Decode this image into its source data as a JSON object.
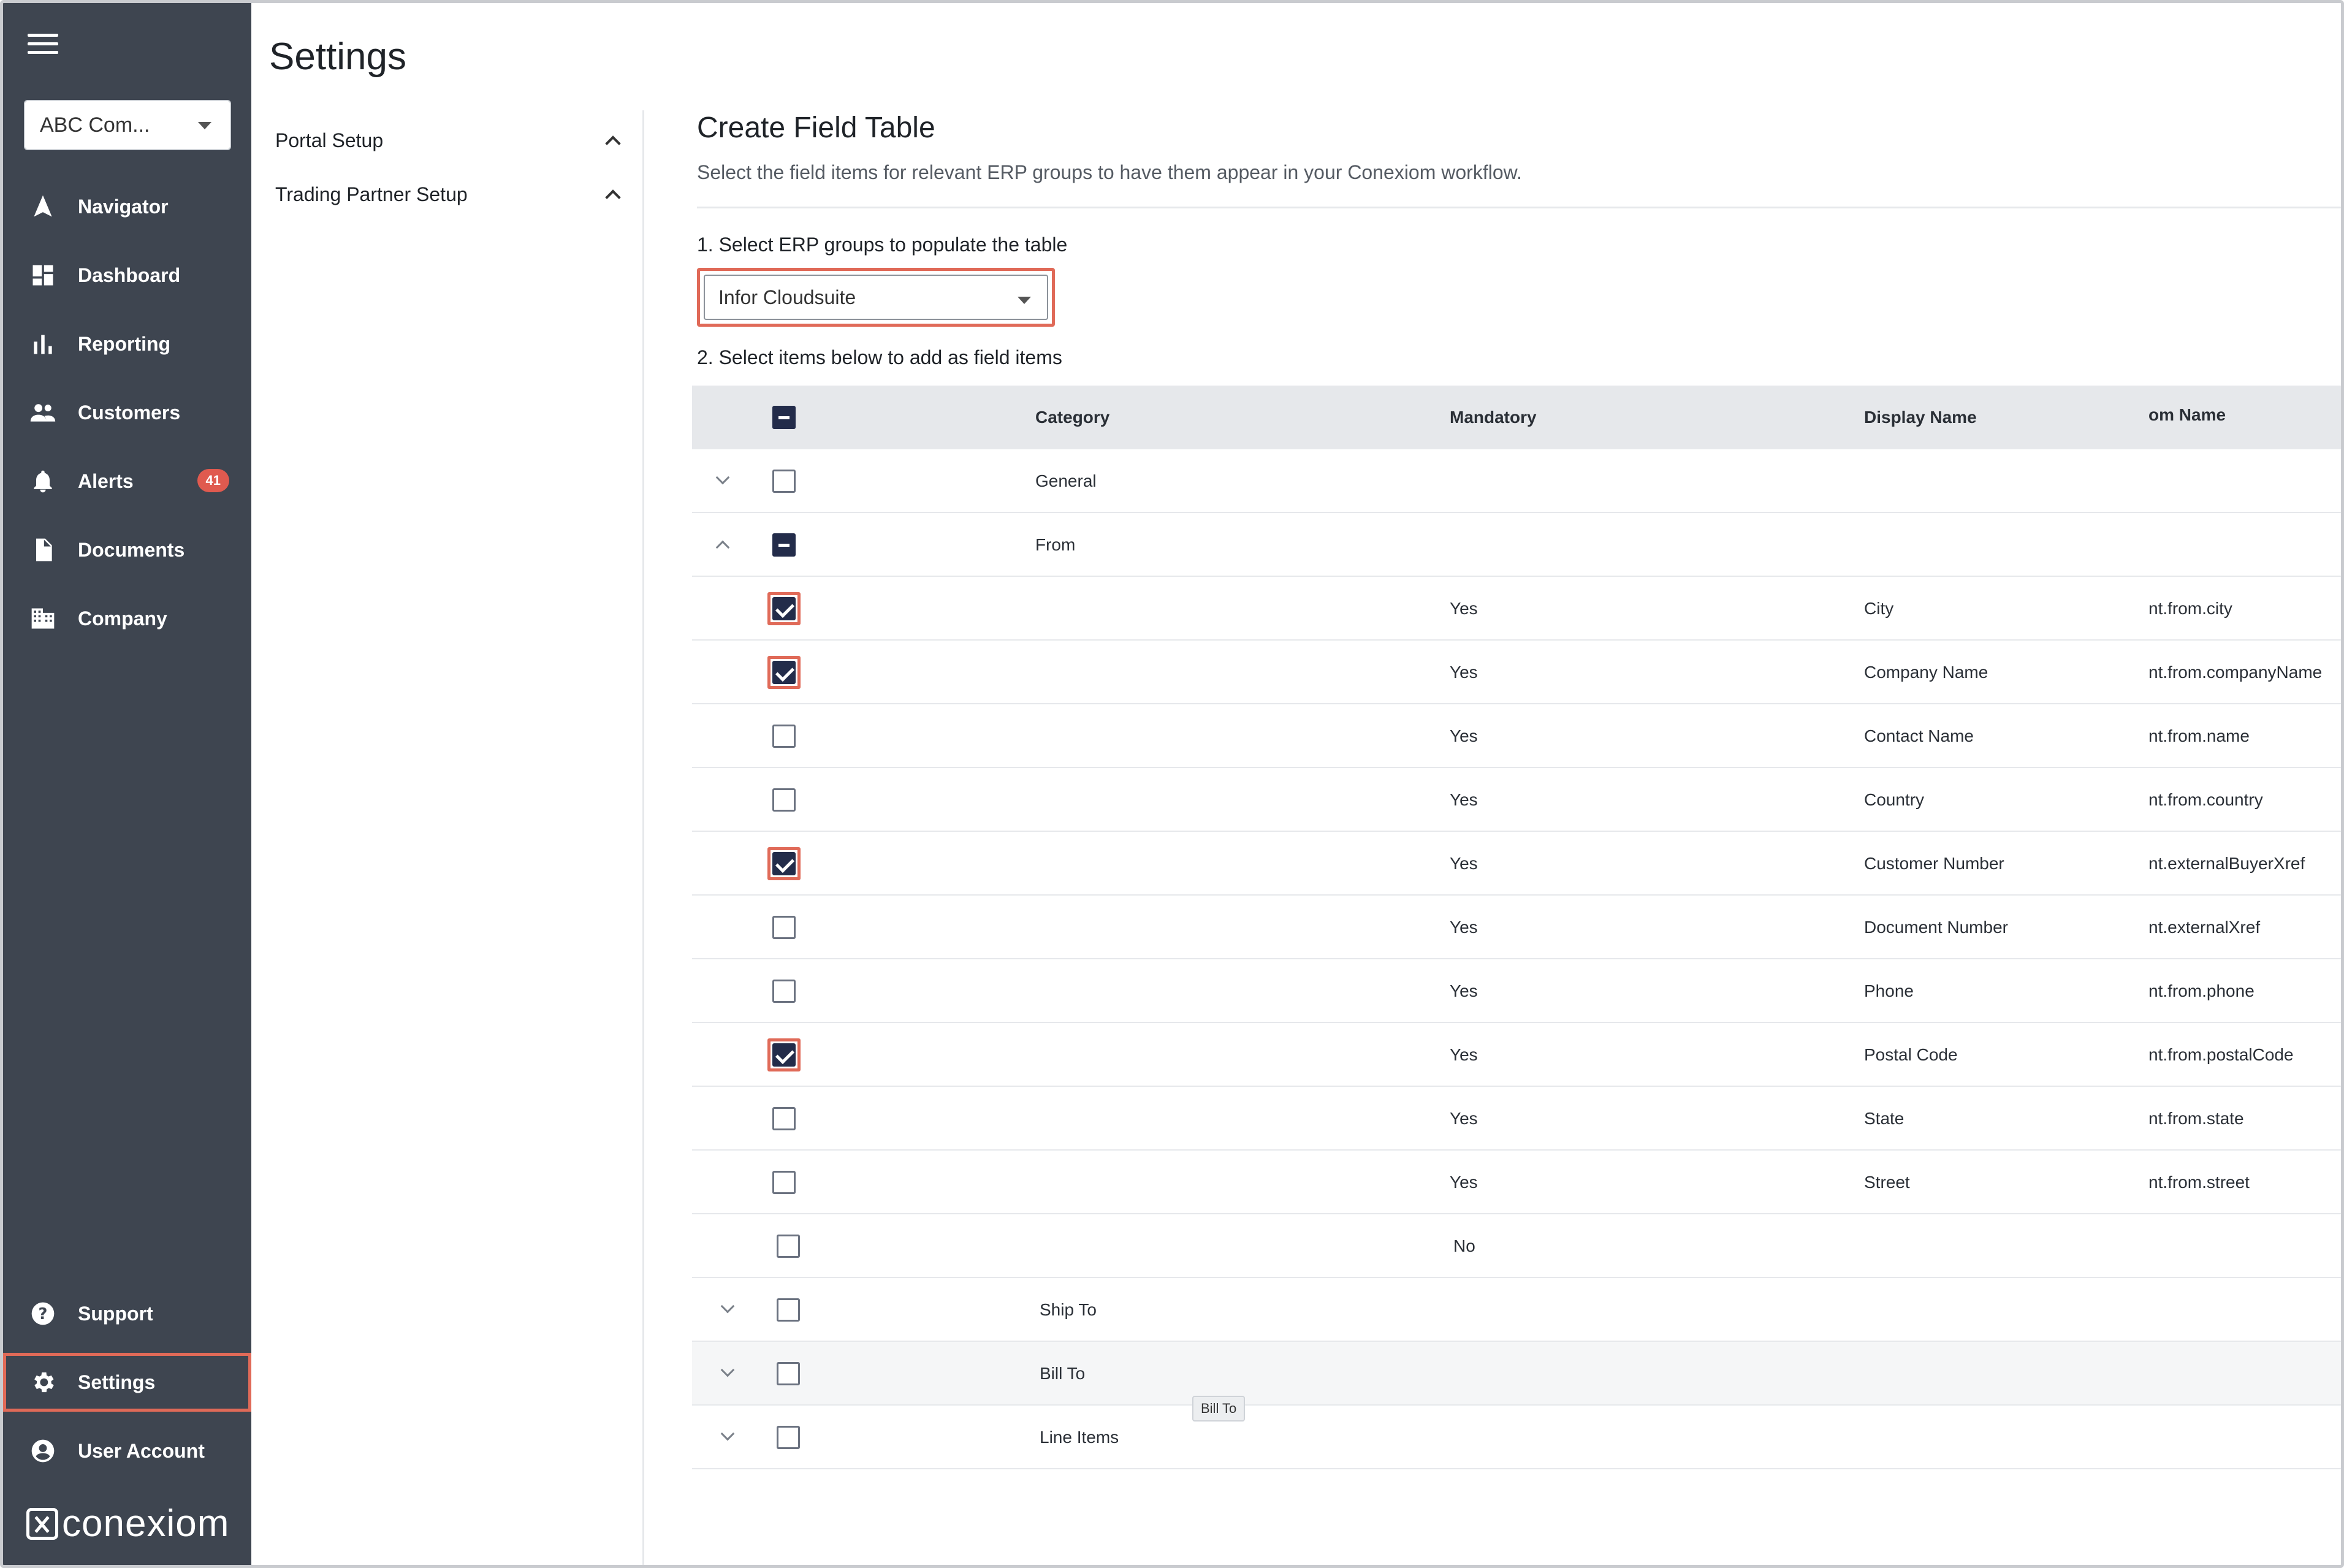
{
  "sidebar": {
    "company_selector": "ABC Com...",
    "nav": [
      {
        "label": "Navigator",
        "icon": "navigator-arrow-icon"
      },
      {
        "label": "Dashboard",
        "icon": "dashboard-icon"
      },
      {
        "label": "Reporting",
        "icon": "bar-chart-icon"
      },
      {
        "label": "Customers",
        "icon": "people-icon"
      },
      {
        "label": "Alerts",
        "icon": "bell-icon",
        "badge": "41"
      },
      {
        "label": "Documents",
        "icon": "document-icon"
      },
      {
        "label": "Company",
        "icon": "building-icon"
      }
    ],
    "bottom_nav": [
      {
        "label": "Support",
        "icon": "help-icon"
      },
      {
        "label": "Settings",
        "icon": "gear-icon",
        "active": true
      },
      {
        "label": "User Account",
        "icon": "user-circle-icon"
      }
    ],
    "logo_text": "conexiom"
  },
  "page": {
    "title": "Settings"
  },
  "subnav": {
    "items": [
      {
        "label": "Portal Setup"
      },
      {
        "label": "Trading Partner Setup"
      }
    ]
  },
  "main": {
    "title": "Create Field Table",
    "description": "Select the field items for relevant ERP groups to have them appear in your Conexiom workflow.",
    "step1": "1. Select ERP groups to populate the table",
    "erp_selected": "Infor Cloudsuite",
    "step2": "2. Select items below to add as field items"
  },
  "table": {
    "columns": [
      "Category",
      "Mandatory",
      "Display Name",
      "om Name"
    ],
    "groups": [
      {
        "category": "General"
      },
      {
        "category": "From"
      },
      {
        "category": "Ship To"
      },
      {
        "category": "Bill To"
      },
      {
        "category": "Line Items"
      }
    ],
    "rows": [
      {
        "mandatory": "Yes",
        "display_name": "City",
        "custom_name": "nt.from.city",
        "checked": true
      },
      {
        "mandatory": "Yes",
        "display_name": "Company Name",
        "custom_name": "nt.from.companyName",
        "checked": true
      },
      {
        "mandatory": "Yes",
        "display_name": "Contact Name",
        "custom_name": "nt.from.name",
        "checked": false
      },
      {
        "mandatory": "Yes",
        "display_name": "Country",
        "custom_name": "nt.from.country",
        "checked": false
      },
      {
        "mandatory": "Yes",
        "display_name": "Customer Number",
        "custom_name": "nt.externalBuyerXref",
        "checked": true
      },
      {
        "mandatory": "Yes",
        "display_name": "Document Number",
        "custom_name": "nt.externalXref",
        "checked": false
      },
      {
        "mandatory": "Yes",
        "display_name": "Phone",
        "custom_name": "nt.from.phone",
        "checked": false
      },
      {
        "mandatory": "Yes",
        "display_name": "Postal Code",
        "custom_name": "nt.from.postalCode",
        "checked": true
      },
      {
        "mandatory": "Yes",
        "display_name": "State",
        "custom_name": "nt.from.state",
        "checked": false
      },
      {
        "mandatory": "Yes",
        "display_name": "Street",
        "custom_name": "nt.from.street",
        "checked": false
      },
      {
        "mandatory": "No",
        "display_name": "",
        "custom_name": "",
        "checked": false
      }
    ],
    "tooltip": "Bill To"
  },
  "colors": {
    "sidebar_bg": "#3e4550",
    "highlight": "#e06a58",
    "checkbox_fill": "#232c4a",
    "badge": "#e05a4f"
  }
}
